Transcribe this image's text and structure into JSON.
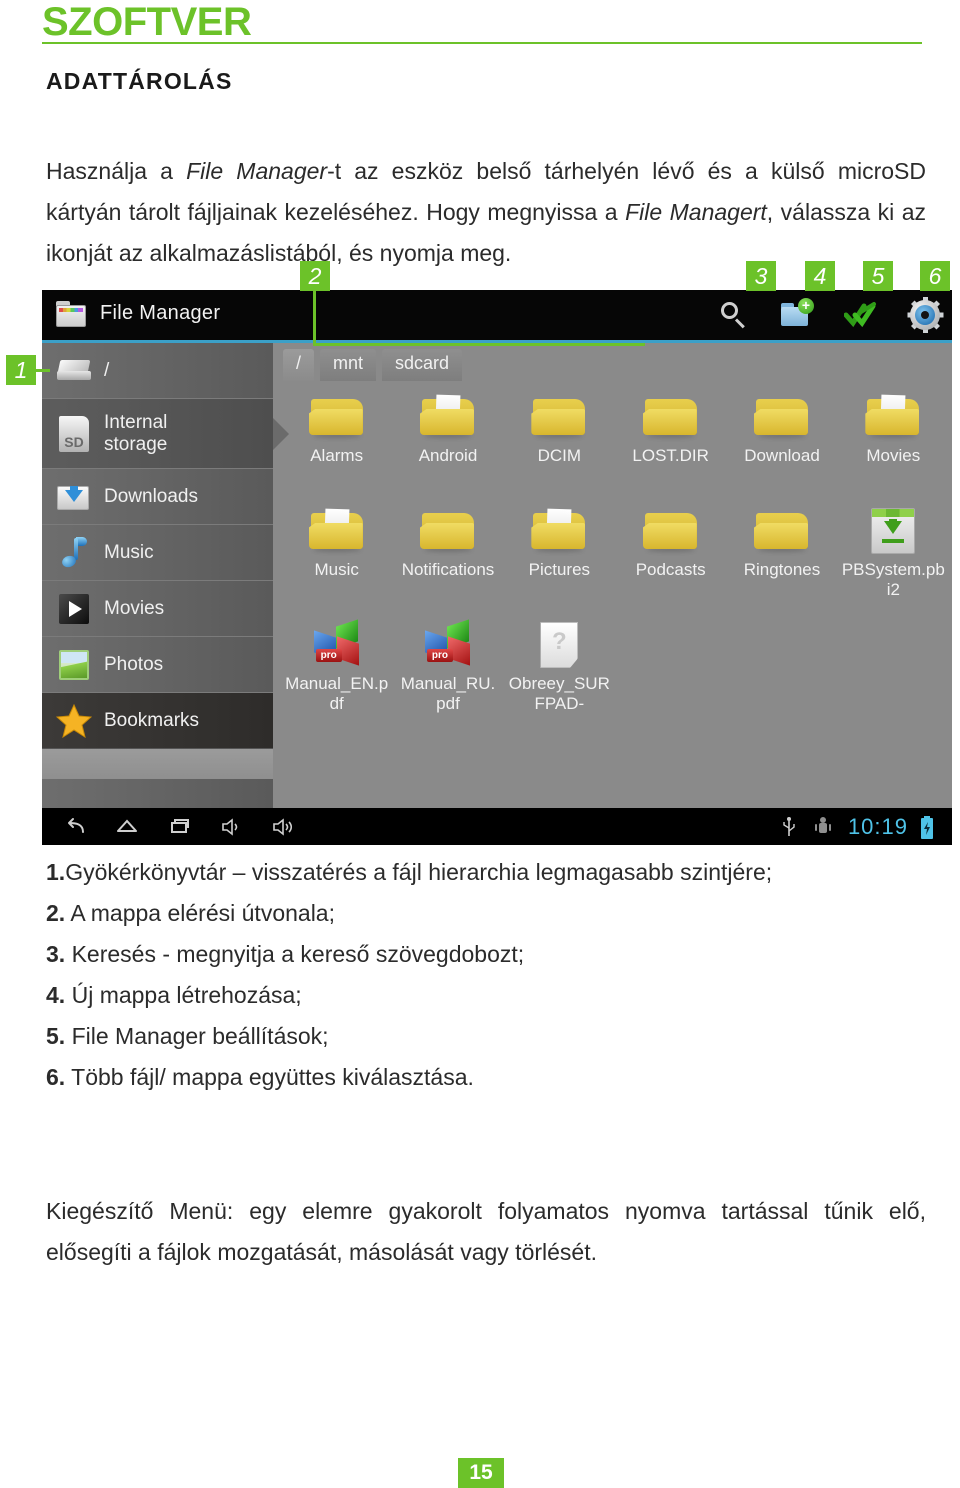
{
  "page": {
    "chapter_title": "SZOFTVER",
    "section_title": "ADATTÁROLÁS",
    "page_number": "15",
    "accent_color": "#6cc229"
  },
  "intro": {
    "part1": "Használja a ",
    "em1": "File Manager",
    "part2": "-t az eszköz belső tárhelyén lévő és a külső microSD kártyán tárolt fájljainak kezeléséhez. Hogy megnyissa a ",
    "em2": "File Managert",
    "part3": ", válassza ki az ikonját az alkalmazáslistából, és nyomja meg."
  },
  "callouts": [
    {
      "id": "1",
      "label": "1"
    },
    {
      "id": "2",
      "label": "2"
    },
    {
      "id": "3",
      "label": "3"
    },
    {
      "id": "4",
      "label": "4"
    },
    {
      "id": "5",
      "label": "5"
    },
    {
      "id": "6",
      "label": "6"
    }
  ],
  "screenshot": {
    "app_title": "File Manager",
    "toolbar": [
      {
        "name": "search-icon",
        "label": "Keresés"
      },
      {
        "name": "new-folder-icon",
        "label": "Új mappa"
      },
      {
        "name": "multi-select-icon",
        "label": "Többszörös kiválasztás"
      },
      {
        "name": "settings-gear-icon",
        "label": "Beállítások"
      }
    ],
    "sidebar": [
      {
        "label": "/",
        "icon": "drive-icon",
        "selected": false
      },
      {
        "label": "Internal storage",
        "icon": "sd-card-icon",
        "selected": true
      },
      {
        "label": "Downloads",
        "icon": "downloads-folder-icon",
        "selected": false
      },
      {
        "label": "Music",
        "icon": "music-note-icon",
        "selected": false
      },
      {
        "label": "Movies",
        "icon": "movies-play-icon",
        "selected": false
      },
      {
        "label": "Photos",
        "icon": "photos-image-icon",
        "selected": false
      },
      {
        "label": "Bookmarks",
        "icon": "star-icon",
        "selected": false
      }
    ],
    "breadcrumbs": [
      "/",
      "mnt",
      "sdcard"
    ],
    "files": [
      {
        "name": "Alarms",
        "type": "folder"
      },
      {
        "name": "Android",
        "type": "folder-papers"
      },
      {
        "name": "DCIM",
        "type": "folder"
      },
      {
        "name": "LOST.DIR",
        "type": "folder"
      },
      {
        "name": "Download",
        "type": "folder"
      },
      {
        "name": "Movies",
        "type": "folder-papers"
      },
      {
        "name": "Music",
        "type": "folder-papers"
      },
      {
        "name": "Notifications",
        "type": "folder"
      },
      {
        "name": "Pictures",
        "type": "folder-papers"
      },
      {
        "name": "Podcasts",
        "type": "folder"
      },
      {
        "name": "Ringtones",
        "type": "folder"
      },
      {
        "name": "PBSystem.pbi2",
        "type": "pbi"
      },
      {
        "name": "Manual_EN.pdf",
        "type": "pdf"
      },
      {
        "name": "Manual_RU.pdf",
        "type": "pdf"
      },
      {
        "name": "Obreey_SURFPAD-",
        "type": "unknown"
      }
    ],
    "systembar": {
      "clock": "10:19",
      "nav": [
        "back-icon",
        "home-icon",
        "recents-icon",
        "volume-down-icon",
        "volume-up-icon"
      ],
      "status": [
        "usb-icon",
        "android-debug-icon",
        "battery-charging-icon"
      ]
    }
  },
  "legend": [
    {
      "num": "1.",
      "text": "Gyökérkönyvtár – visszatérés a fájl hierarchia legmagasabb szintjére;"
    },
    {
      "num": "2.",
      "text": "A mappa elérési útvonala;"
    },
    {
      "num": "3.",
      "text": "Keresés  - megnyitja a kereső szövegdobozt;"
    },
    {
      "num": "4.",
      "text": "Új mappa létrehozása;"
    },
    {
      "num": "5.",
      "text": "File Manager beállítások;"
    },
    {
      "num": "6.",
      "text": "Több fájl/ mappa együttes kiválasztása."
    }
  ],
  "outro": {
    "text": "Kiegészítő Menü: egy elemre gyakorolt folyamatos nyomva tartással tűnik elő, elősegíti a fájlok mozgatását, másolását vagy törlését."
  }
}
